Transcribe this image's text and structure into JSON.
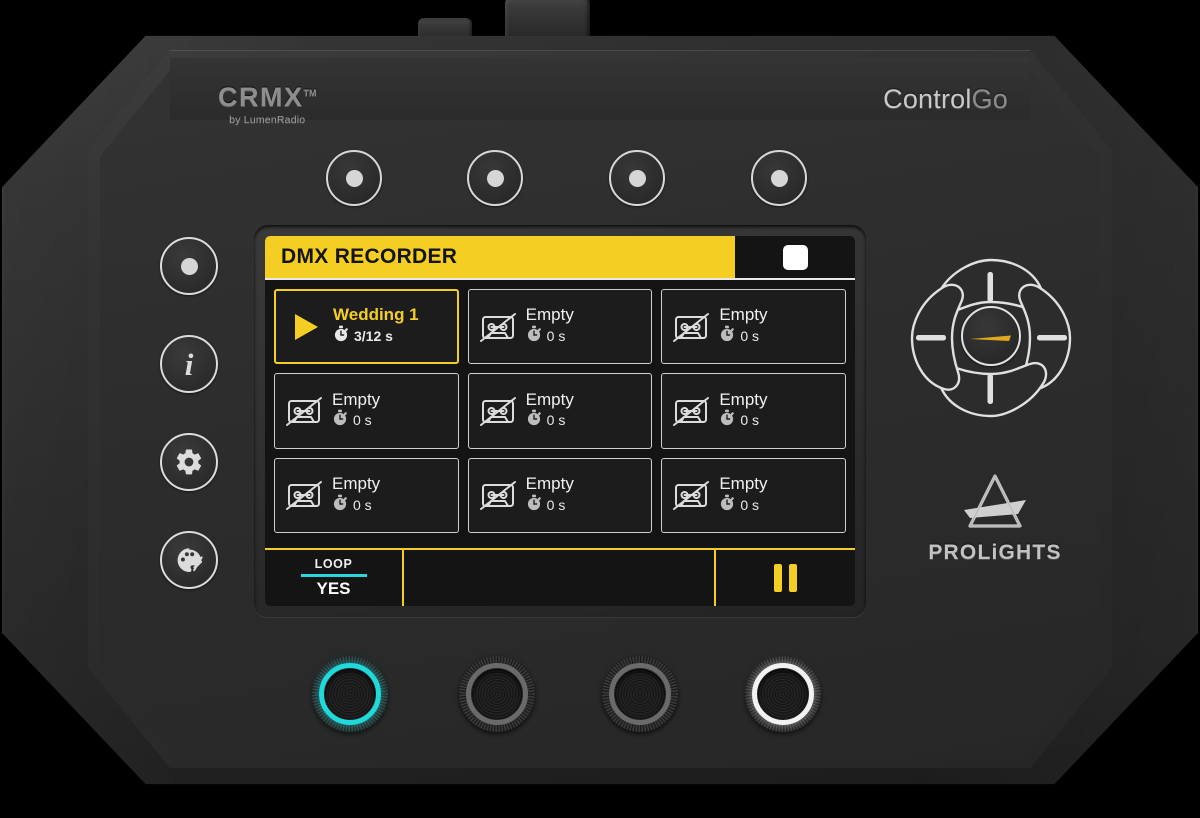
{
  "device": {
    "brand_logo": "CRMX",
    "brand_tm": "TM",
    "brand_sub": "by LumenRadio",
    "model_part1": "Control",
    "model_part2": "Go",
    "vendor_logo_text": "PROLiGHTS"
  },
  "screen": {
    "title": "DMX RECORDER",
    "header_indicator": "record-stop-square",
    "accent_color": "#F5CE23",
    "background_color": "#141414",
    "cyan_color": "#2AD4DC",
    "slots": [
      {
        "name": "Wedding 1",
        "time": "3/12 s",
        "state": "playing",
        "icon": "play-icon"
      },
      {
        "name": "Empty",
        "time": "0 s",
        "state": "empty",
        "icon": "no-tape-icon"
      },
      {
        "name": "Empty",
        "time": "0 s",
        "state": "empty",
        "icon": "no-tape-icon"
      },
      {
        "name": "Empty",
        "time": "0 s",
        "state": "empty",
        "icon": "no-tape-icon"
      },
      {
        "name": "Empty",
        "time": "0 s",
        "state": "empty",
        "icon": "no-tape-icon"
      },
      {
        "name": "Empty",
        "time": "0 s",
        "state": "empty",
        "icon": "no-tape-icon"
      },
      {
        "name": "Empty",
        "time": "0 s",
        "state": "empty",
        "icon": "no-tape-icon"
      },
      {
        "name": "Empty",
        "time": "0 s",
        "state": "empty",
        "icon": "no-tape-icon"
      },
      {
        "name": "Empty",
        "time": "0 s",
        "state": "empty",
        "icon": "no-tape-icon"
      }
    ],
    "footer": {
      "loop_label": "LOOP",
      "loop_value": "YES",
      "middle_label": "",
      "right_icon": "pause-icon"
    }
  },
  "controls": {
    "top_buttons": [
      {
        "name": "soft-button-1",
        "icon": "dot-icon"
      },
      {
        "name": "soft-button-2",
        "icon": "dot-icon"
      },
      {
        "name": "soft-button-3",
        "icon": "dot-icon"
      },
      {
        "name": "soft-button-4",
        "icon": "dot-icon"
      }
    ],
    "left_buttons": [
      {
        "name": "record-button",
        "icon": "dot-icon"
      },
      {
        "name": "info-button",
        "icon": "info-icon",
        "glyph": "i"
      },
      {
        "name": "settings-button",
        "icon": "gear-icon"
      },
      {
        "name": "palette-button",
        "icon": "palette-icon"
      }
    ],
    "nav_pad": {
      "up": "nav-up-button",
      "down": "nav-down-button",
      "left": "nav-left-button",
      "right": "nav-right-button",
      "center": "nav-enter-button"
    },
    "encoders": [
      {
        "name": "encoder-1",
        "led": "cyan",
        "led_color": "#1FD9DA"
      },
      {
        "name": "encoder-2",
        "led": "off",
        "led_color": "#6E6E6E"
      },
      {
        "name": "encoder-3",
        "led": "off",
        "led_color": "#6E6E6E"
      },
      {
        "name": "encoder-4",
        "led": "white",
        "led_color": "#F2F2F2"
      }
    ],
    "connectors": [
      {
        "name": "antenna-connector-large"
      },
      {
        "name": "antenna-connector-small"
      },
      {
        "name": "side-port"
      }
    ]
  }
}
